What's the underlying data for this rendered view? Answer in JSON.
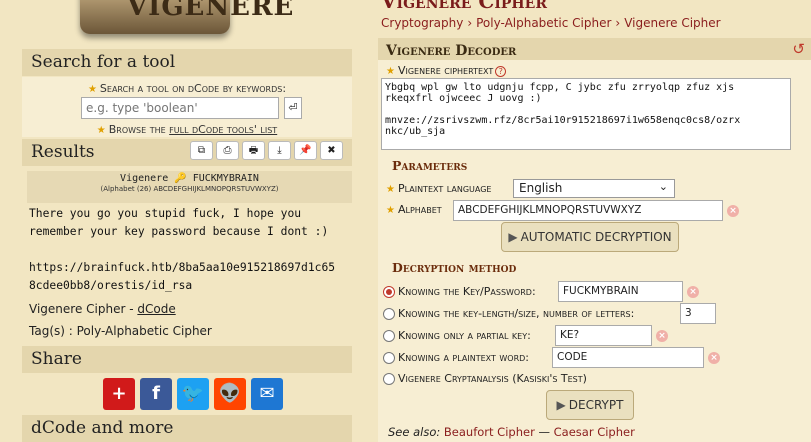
{
  "sidebar": {
    "logo_text": "VIGENERE",
    "search_title": "Search for a tool",
    "search_keywords_label": "Search a tool on dCode by keywords:",
    "search_placeholder": "e.g. type 'boolean'",
    "search_go": "⏎",
    "browse_prefix": "Browse the",
    "browse_link": "full dCode tools' list",
    "results_title": "Results",
    "results_tools": [
      "⧉",
      "⎙",
      "🖶",
      "⤓",
      "📌",
      "✖"
    ],
    "result_header_title": "Vigenere 🔑 FUCKMYBRAIN",
    "result_header_alpha": "(Alphabet (26) ABCDEFGHIJKLMNOPQRSTUVWXYZ)",
    "result_text": "There you go you stupid fuck, I hope you\nremember your key password because I dont :)\n\nhttps://brainfuck.htb/8ba5aa10e915218697d1c65\n8cdee0bb8/orestis/id_rsa",
    "tag_line_1_prefix": "Vigenere Cipher - ",
    "tag_line_1_link": "dCode",
    "tag_line_2": "Tag(s) : Poly-Alphabetic Cipher",
    "share_title": "Share",
    "share_buttons": [
      {
        "label": "+",
        "color": "#d11a1a"
      },
      {
        "label": "f",
        "color": "#3b5998"
      },
      {
        "label": "🐦",
        "color": "#1da1f2"
      },
      {
        "label": "👽",
        "color": "#ff4500"
      },
      {
        "label": "✉",
        "color": "#1e77d3"
      }
    ],
    "more_title": "dCode and more"
  },
  "main": {
    "page_title": "Vigenere Cipher",
    "breadcrumb": [
      "Cryptography",
      "Poly-Alphabetic Cipher",
      "Vigenere Cipher"
    ],
    "panel_title": "Vigenere Decoder",
    "ciphertext_label": "Vigenere ciphertext",
    "ciphertext_value": "Ybgbq wpl gw lto udgnju fcpp, C jybc zfu zrryolqp zfuz xjs\nrkeqxfrl ojwceec J uovg :)\n\nmnvze://zsrivszwm.rfz/8cr5ai10r915218697i1w658enqc0cs8/ozrx\nnkc/ub_sja",
    "parameters_title": "Parameters",
    "plaintext_language_label": "Plaintext language",
    "plaintext_language_value": "English",
    "alphabet_label": "Alphabet",
    "alphabet_value": "ABCDEFGHIJKLMNOPQRSTUVWXYZ",
    "auto_decrypt_label": "AUTOMATIC DECRYPTION",
    "decryption_method_title": "Decryption method",
    "methods": [
      {
        "label": "Knowing the Key/Password:",
        "value": "FUCKMYBRAIN",
        "selected": true
      },
      {
        "label": "Knowing the key-length/size, number of letters:",
        "value": "3",
        "selected": false
      },
      {
        "label": "Knowing only a partial key:",
        "value": "KE?",
        "selected": false
      },
      {
        "label": "Knowing a plaintext word:",
        "value": "CODE",
        "selected": false
      },
      {
        "label": "Vigenere Cryptanalysis (Kasiski's Test)",
        "value": "",
        "selected": false
      }
    ],
    "decrypt_label": "DECRYPT",
    "see_also_prefix": "See also:",
    "see_also_links": [
      "Beaufort Cipher",
      "Caesar Cipher"
    ],
    "see_also_sep": "—"
  }
}
